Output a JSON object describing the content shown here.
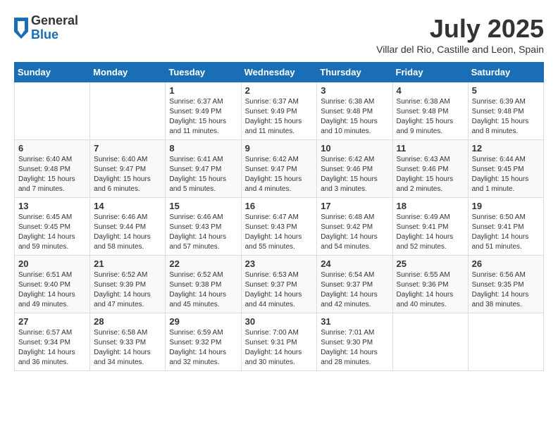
{
  "header": {
    "logo_general": "General",
    "logo_blue": "Blue",
    "month_title": "July 2025",
    "subtitle": "Villar del Rio, Castille and Leon, Spain"
  },
  "weekdays": [
    "Sunday",
    "Monday",
    "Tuesday",
    "Wednesday",
    "Thursday",
    "Friday",
    "Saturday"
  ],
  "weeks": [
    [
      {
        "day": "",
        "sunrise": "",
        "sunset": "",
        "daylight": ""
      },
      {
        "day": "",
        "sunrise": "",
        "sunset": "",
        "daylight": ""
      },
      {
        "day": "1",
        "sunrise": "Sunrise: 6:37 AM",
        "sunset": "Sunset: 9:49 PM",
        "daylight": "Daylight: 15 hours and 11 minutes."
      },
      {
        "day": "2",
        "sunrise": "Sunrise: 6:37 AM",
        "sunset": "Sunset: 9:49 PM",
        "daylight": "Daylight: 15 hours and 11 minutes."
      },
      {
        "day": "3",
        "sunrise": "Sunrise: 6:38 AM",
        "sunset": "Sunset: 9:48 PM",
        "daylight": "Daylight: 15 hours and 10 minutes."
      },
      {
        "day": "4",
        "sunrise": "Sunrise: 6:38 AM",
        "sunset": "Sunset: 9:48 PM",
        "daylight": "Daylight: 15 hours and 9 minutes."
      },
      {
        "day": "5",
        "sunrise": "Sunrise: 6:39 AM",
        "sunset": "Sunset: 9:48 PM",
        "daylight": "Daylight: 15 hours and 8 minutes."
      }
    ],
    [
      {
        "day": "6",
        "sunrise": "Sunrise: 6:40 AM",
        "sunset": "Sunset: 9:48 PM",
        "daylight": "Daylight: 15 hours and 7 minutes."
      },
      {
        "day": "7",
        "sunrise": "Sunrise: 6:40 AM",
        "sunset": "Sunset: 9:47 PM",
        "daylight": "Daylight: 15 hours and 6 minutes."
      },
      {
        "day": "8",
        "sunrise": "Sunrise: 6:41 AM",
        "sunset": "Sunset: 9:47 PM",
        "daylight": "Daylight: 15 hours and 5 minutes."
      },
      {
        "day": "9",
        "sunrise": "Sunrise: 6:42 AM",
        "sunset": "Sunset: 9:47 PM",
        "daylight": "Daylight: 15 hours and 4 minutes."
      },
      {
        "day": "10",
        "sunrise": "Sunrise: 6:42 AM",
        "sunset": "Sunset: 9:46 PM",
        "daylight": "Daylight: 15 hours and 3 minutes."
      },
      {
        "day": "11",
        "sunrise": "Sunrise: 6:43 AM",
        "sunset": "Sunset: 9:46 PM",
        "daylight": "Daylight: 15 hours and 2 minutes."
      },
      {
        "day": "12",
        "sunrise": "Sunrise: 6:44 AM",
        "sunset": "Sunset: 9:45 PM",
        "daylight": "Daylight: 15 hours and 1 minute."
      }
    ],
    [
      {
        "day": "13",
        "sunrise": "Sunrise: 6:45 AM",
        "sunset": "Sunset: 9:45 PM",
        "daylight": "Daylight: 14 hours and 59 minutes."
      },
      {
        "day": "14",
        "sunrise": "Sunrise: 6:46 AM",
        "sunset": "Sunset: 9:44 PM",
        "daylight": "Daylight: 14 hours and 58 minutes."
      },
      {
        "day": "15",
        "sunrise": "Sunrise: 6:46 AM",
        "sunset": "Sunset: 9:43 PM",
        "daylight": "Daylight: 14 hours and 57 minutes."
      },
      {
        "day": "16",
        "sunrise": "Sunrise: 6:47 AM",
        "sunset": "Sunset: 9:43 PM",
        "daylight": "Daylight: 14 hours and 55 minutes."
      },
      {
        "day": "17",
        "sunrise": "Sunrise: 6:48 AM",
        "sunset": "Sunset: 9:42 PM",
        "daylight": "Daylight: 14 hours and 54 minutes."
      },
      {
        "day": "18",
        "sunrise": "Sunrise: 6:49 AM",
        "sunset": "Sunset: 9:41 PM",
        "daylight": "Daylight: 14 hours and 52 minutes."
      },
      {
        "day": "19",
        "sunrise": "Sunrise: 6:50 AM",
        "sunset": "Sunset: 9:41 PM",
        "daylight": "Daylight: 14 hours and 51 minutes."
      }
    ],
    [
      {
        "day": "20",
        "sunrise": "Sunrise: 6:51 AM",
        "sunset": "Sunset: 9:40 PM",
        "daylight": "Daylight: 14 hours and 49 minutes."
      },
      {
        "day": "21",
        "sunrise": "Sunrise: 6:52 AM",
        "sunset": "Sunset: 9:39 PM",
        "daylight": "Daylight: 14 hours and 47 minutes."
      },
      {
        "day": "22",
        "sunrise": "Sunrise: 6:52 AM",
        "sunset": "Sunset: 9:38 PM",
        "daylight": "Daylight: 14 hours and 45 minutes."
      },
      {
        "day": "23",
        "sunrise": "Sunrise: 6:53 AM",
        "sunset": "Sunset: 9:37 PM",
        "daylight": "Daylight: 14 hours and 44 minutes."
      },
      {
        "day": "24",
        "sunrise": "Sunrise: 6:54 AM",
        "sunset": "Sunset: 9:37 PM",
        "daylight": "Daylight: 14 hours and 42 minutes."
      },
      {
        "day": "25",
        "sunrise": "Sunrise: 6:55 AM",
        "sunset": "Sunset: 9:36 PM",
        "daylight": "Daylight: 14 hours and 40 minutes."
      },
      {
        "day": "26",
        "sunrise": "Sunrise: 6:56 AM",
        "sunset": "Sunset: 9:35 PM",
        "daylight": "Daylight: 14 hours and 38 minutes."
      }
    ],
    [
      {
        "day": "27",
        "sunrise": "Sunrise: 6:57 AM",
        "sunset": "Sunset: 9:34 PM",
        "daylight": "Daylight: 14 hours and 36 minutes."
      },
      {
        "day": "28",
        "sunrise": "Sunrise: 6:58 AM",
        "sunset": "Sunset: 9:33 PM",
        "daylight": "Daylight: 14 hours and 34 minutes."
      },
      {
        "day": "29",
        "sunrise": "Sunrise: 6:59 AM",
        "sunset": "Sunset: 9:32 PM",
        "daylight": "Daylight: 14 hours and 32 minutes."
      },
      {
        "day": "30",
        "sunrise": "Sunrise: 7:00 AM",
        "sunset": "Sunset: 9:31 PM",
        "daylight": "Daylight: 14 hours and 30 minutes."
      },
      {
        "day": "31",
        "sunrise": "Sunrise: 7:01 AM",
        "sunset": "Sunset: 9:30 PM",
        "daylight": "Daylight: 14 hours and 28 minutes."
      },
      {
        "day": "",
        "sunrise": "",
        "sunset": "",
        "daylight": ""
      },
      {
        "day": "",
        "sunrise": "",
        "sunset": "",
        "daylight": ""
      }
    ]
  ]
}
